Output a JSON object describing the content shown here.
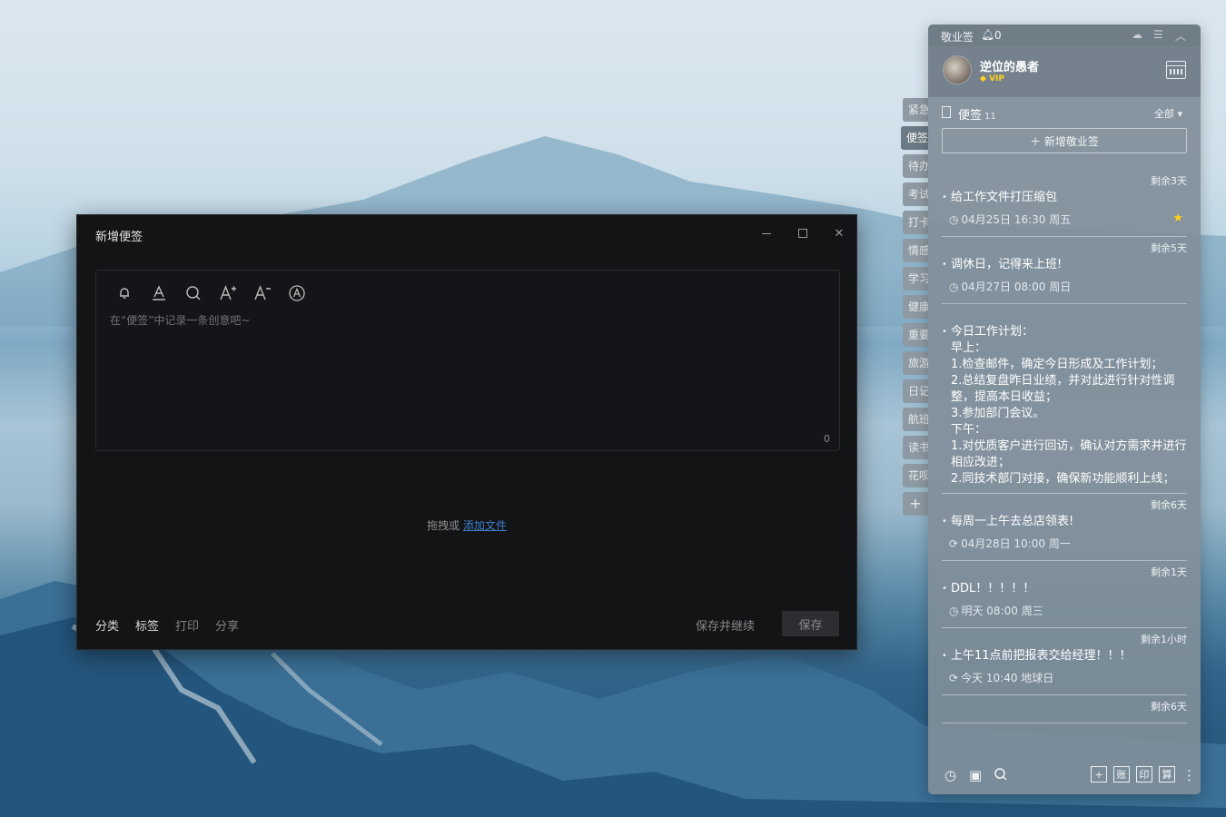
{
  "editor": {
    "title": "新增便签",
    "placeholder": "在“便签”中记录一条创意吧~",
    "char_count": "0",
    "drop_text": "拖拽或",
    "add_file_link": "添加文件",
    "footer_left": [
      "分类",
      "标签",
      "打印",
      "分享"
    ],
    "save_continue": "保存并继续",
    "save": "保存",
    "tool_icons": [
      "bell-icon",
      "font-color-icon",
      "search-icon",
      "font-increase-icon",
      "font-decrease-icon",
      "clear-format-icon"
    ]
  },
  "tabs": [
    "紧急",
    "便签",
    "待办",
    "考试",
    "打卡",
    "情感",
    "学习",
    "健康",
    "重要",
    "旅游",
    "日记",
    "航班",
    "读书",
    "花呗"
  ],
  "active_tab": "便签",
  "panel": {
    "app_name": "敬业签",
    "bell_count": "0",
    "user_name": "逆位的愚者",
    "vip_label": "VIP",
    "section_title": "便签",
    "section_count": "11",
    "filter": "全部",
    "new_button": "新增敬业签",
    "items": [
      {
        "remain": "剩余3天",
        "text": "给工作文件打压缩包",
        "meta": "04月25日 16:30 周五",
        "starred": true,
        "repeat": false
      },
      {
        "remain": "剩余5天",
        "text": "调休日，记得来上班!",
        "meta": "04月27日 08:00 周日",
        "starred": false,
        "repeat": false
      },
      {
        "remain": "",
        "text": "今日工作计划：\n早上：\n1.检查邮件，确定今日形成及工作计划；\n2.总结复盘昨日业绩，并对此进行针对性调整，提高本日收益；\n3.参加部门会议。\n下午：\n1.对优质客户进行回访，确认对方需求并进行相应改进；\n2.同技术部门对接，确保新功能顺利上线；",
        "meta": "",
        "starred": false,
        "repeat": false
      },
      {
        "remain": "剩余6天",
        "text": "每周一上午去总店领表!",
        "meta": "04月28日 10:00 周一",
        "starred": false,
        "repeat": true
      },
      {
        "remain": "剩余1天",
        "text": "DDL！！！！！",
        "meta": "明天 08:00 周三",
        "starred": false,
        "repeat": false
      },
      {
        "remain": "剩余1小时",
        "text": "上午11点前把报表交给经理！！！",
        "meta": "今天 10:40 地球日",
        "starred": false,
        "repeat": true
      },
      {
        "remain": "剩余6天",
        "text": "",
        "meta": "",
        "starred": false,
        "repeat": false
      }
    ],
    "bottom_squares": [
      "+",
      "账",
      "印",
      "算"
    ]
  }
}
